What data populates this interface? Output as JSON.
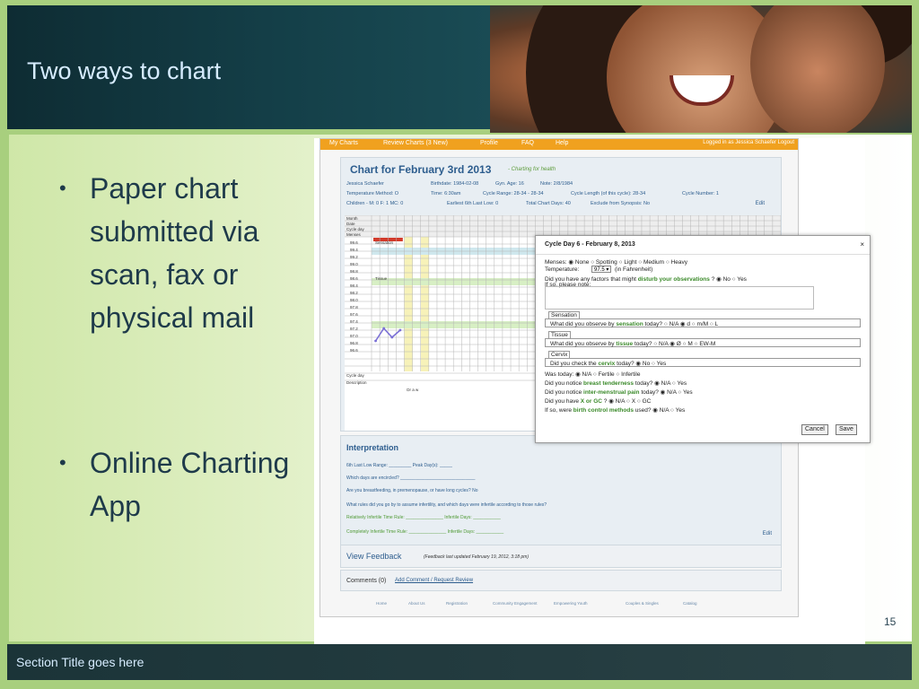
{
  "slide": {
    "title": "Two ways to chart",
    "footer": "Section Title goes here",
    "page_number": "15"
  },
  "bullets": [
    {
      "text": "Paper chart submitted via scan, fax or physical mail"
    },
    {
      "text": "Online Charting App"
    }
  ],
  "app": {
    "nav": [
      "My Charts",
      "Review Charts (3 New)",
      "Profile",
      "FAQ",
      "Help"
    ],
    "login_text": "Logged in as Jessica Schaefer  Logout",
    "chart_title": "Chart for February 3rd 2013",
    "chart_subtitle": "- Charting for health",
    "info": {
      "name": "Jessica Schaefer",
      "birthdate": "Birthdate: 1984-02-08",
      "gyn_age": "Gyn. Age: 16",
      "note": "Note: 2/8/1984",
      "temp_method": "Temperature Method: O",
      "time": "Time: 6:30am",
      "cycle_range": "Cycle Range: 28-34 - 28-34",
      "cycle_length": "Cycle Length (of this cycle): 28-34",
      "cycle_number": "Cycle Number: 1",
      "children": "Children - M: 0  F: 1  MC: 0",
      "earliest": "Earliest 6th Last Low: 0",
      "total_days": "Total Chart Days: 40",
      "exclude": "Exclude from Synopsis: No"
    },
    "edit": "Edit",
    "grid_rows": [
      "Month",
      "Date",
      "Cycle day",
      "Menses"
    ],
    "temps": [
      "99.6",
      "99.4",
      "99.2",
      "99.0",
      "98.8",
      "98.6",
      "98.4",
      "98.2",
      "98.0",
      "97.8",
      "97.6",
      "97.4",
      "97.2",
      "97.0",
      "96.8",
      "96.6"
    ],
    "grid_labels": {
      "sensation": "Sensation",
      "tissue": "Tissue",
      "cycle_day": "Cycle day",
      "description": "Description",
      "draw": "Dr a w"
    },
    "interpretation": {
      "title": "Interpretation",
      "q1": "6th Last Low Range: _________    Peak Day(s): _____",
      "q2": "Which days are encircled? ______________________________",
      "q3": "Are you breastfeeding, in premenopause, or have long cycles? No",
      "q4": "What rules did you go by to assume infertility, and which days were infertile according to those rules?",
      "q5": "Relatively Infertile Time Rule: _______________     Infertile Days: ___________",
      "q6": "Completely Infertile Time Rule: _______________     Infertile Days: ___________",
      "edit": "Edit"
    },
    "feedback": {
      "link": "View Feedback",
      "note": "(Feedback last updated February 19, 2012, 3:18 pm)"
    },
    "comments": {
      "label": "Comments (0)",
      "link": "Add Comment / Request Review"
    },
    "footer_links": [
      "Home",
      "About Us",
      "Registration",
      "Community Engagement",
      "Empowering Youth",
      "Couples & Singles",
      "Catalog"
    ]
  },
  "dialog": {
    "title": "Cycle Day 6 - February 8, 2013",
    "close": "×",
    "menses": "Menses:  ◉ None  ○ Spotting  ○ Light  ○ Medium  ○ Heavy",
    "temp_label": "Temperature:",
    "temp_value": "97.5 ▾",
    "temp_unit": "(in Fahrenheit)",
    "factors_prefix": "Did you have any factors that might",
    "factors_green": "disturb your observations",
    "factors_suffix": "?  ◉ No  ○ Yes",
    "note_label": "If so, please note:",
    "sensation_label": "Sensation",
    "sensation_q_prefix": "What did you observe by",
    "sensation_q_green": "sensation",
    "sensation_q_suffix": "today?  ○ N/A  ◉ d  ○ m/M  ○ L",
    "tissue_label": "Tissue",
    "tissue_q_prefix": "What did you observe by",
    "tissue_q_green": "tissue",
    "tissue_q_suffix": "today?  ○ N/A  ◉ Ø  ○ M  ○ EW-M",
    "cervix_label": "Cervix",
    "cervix_q_prefix": "Did you check the",
    "cervix_q_green": "cervix",
    "cervix_q_suffix": "today?  ◉ No  ○ Yes",
    "was_today": "Was today:  ◉ N/A  ○ Fertile  ○ Infertile",
    "breast_prefix": "Did you notice",
    "breast_green": "breast tenderness",
    "breast_suffix": "today?  ◉ N/A  ○ Yes",
    "inter_prefix": "Did you notice",
    "inter_green": "inter-menstrual pain",
    "inter_suffix": "today?  ◉ N/A  ○ Yes",
    "xgc_prefix": "Did you have",
    "xgc_green": "X or GC",
    "xgc_suffix": "?  ◉ N/A  ○ X  ○ GC",
    "bc_prefix": "If so, were",
    "bc_green": "birth control methods",
    "bc_suffix": "used?  ◉ N/A  ○ Yes",
    "cancel": "Cancel",
    "save": "Save"
  }
}
